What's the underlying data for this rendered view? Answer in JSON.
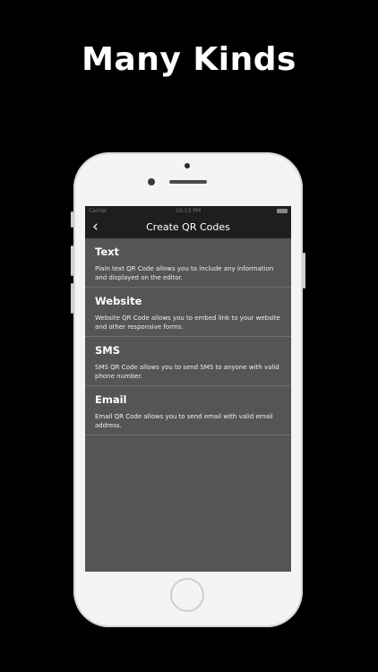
{
  "headline": "Many Kinds",
  "status_bar": {
    "carrier": "Carrier",
    "time": "10:13 PM"
  },
  "nav": {
    "back_icon": "chevron-left-icon",
    "back_glyph": "‹",
    "title": "Create QR Codes"
  },
  "qr_types": [
    {
      "name": "Text",
      "description": "Plain text QR Code allows you to include any information and displayed on the editor."
    },
    {
      "name": "Website",
      "description": "Website QR Code allows you to embed link to your website and other responsive forms."
    },
    {
      "name": "SMS",
      "description": "SMS QR Code allows you to send SMS to anyone with valid phone number."
    },
    {
      "name": "Email",
      "description": "Email QR Code allows you to send email with valid email address."
    }
  ],
  "colors": {
    "background": "#000000",
    "phone_body": "#f4f4f4",
    "nav_bar": "#1e1e1e",
    "list_background": "#555555",
    "text": "#ffffff"
  }
}
